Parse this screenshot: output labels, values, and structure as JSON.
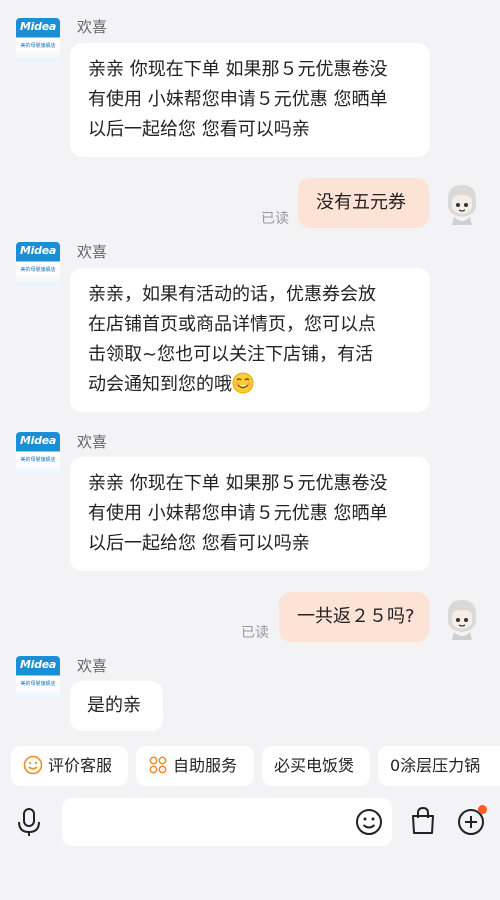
{
  "seller": {
    "name": "欢喜",
    "avatar_logo": "Midea",
    "avatar_sub": "美的母婴旗舰店"
  },
  "messages": [
    {
      "side": "left",
      "text_lines": [
        "亲亲 你现在下单 如果那５元优惠卷没",
        "有使用 小妹帮您申请５元优惠 您晒单",
        "以后一起给您 您看可以吗亲"
      ]
    },
    {
      "side": "right",
      "text": "没有五元券",
      "read": "已读"
    },
    {
      "side": "left",
      "text_lines": [
        "亲亲，如果有活动的话，优惠券会放",
        "在店铺首页或商品详情页，您可以点",
        "击领取~您也可以关注下店铺，有活",
        "动会通知到您的哦"
      ],
      "emoji": "smiling-emoji"
    },
    {
      "side": "left",
      "text_lines": [
        "亲亲 你现在下单 如果那５元优惠卷没",
        "有使用 小妹帮您申请５元优惠 您晒单",
        "以后一起给您 您看可以吗亲"
      ]
    },
    {
      "side": "right",
      "text": "一共返２５吗?",
      "read": "已读"
    },
    {
      "side": "left",
      "text_lines": [
        "是的亲"
      ]
    }
  ],
  "quick_actions": [
    {
      "label": "评价客服",
      "icon": "smile-icon"
    },
    {
      "label": "自助服务",
      "icon": "grid-icon"
    },
    {
      "label": "必买电饭煲"
    },
    {
      "label": "0涂层压力锅"
    }
  ],
  "input": {
    "placeholder": ""
  },
  "colors": {
    "background": "#f3f3f5",
    "outgoing_bubble": "#fde3d6",
    "incoming_bubble": "#ffffff",
    "notification_dot": "#ff5a1f"
  }
}
